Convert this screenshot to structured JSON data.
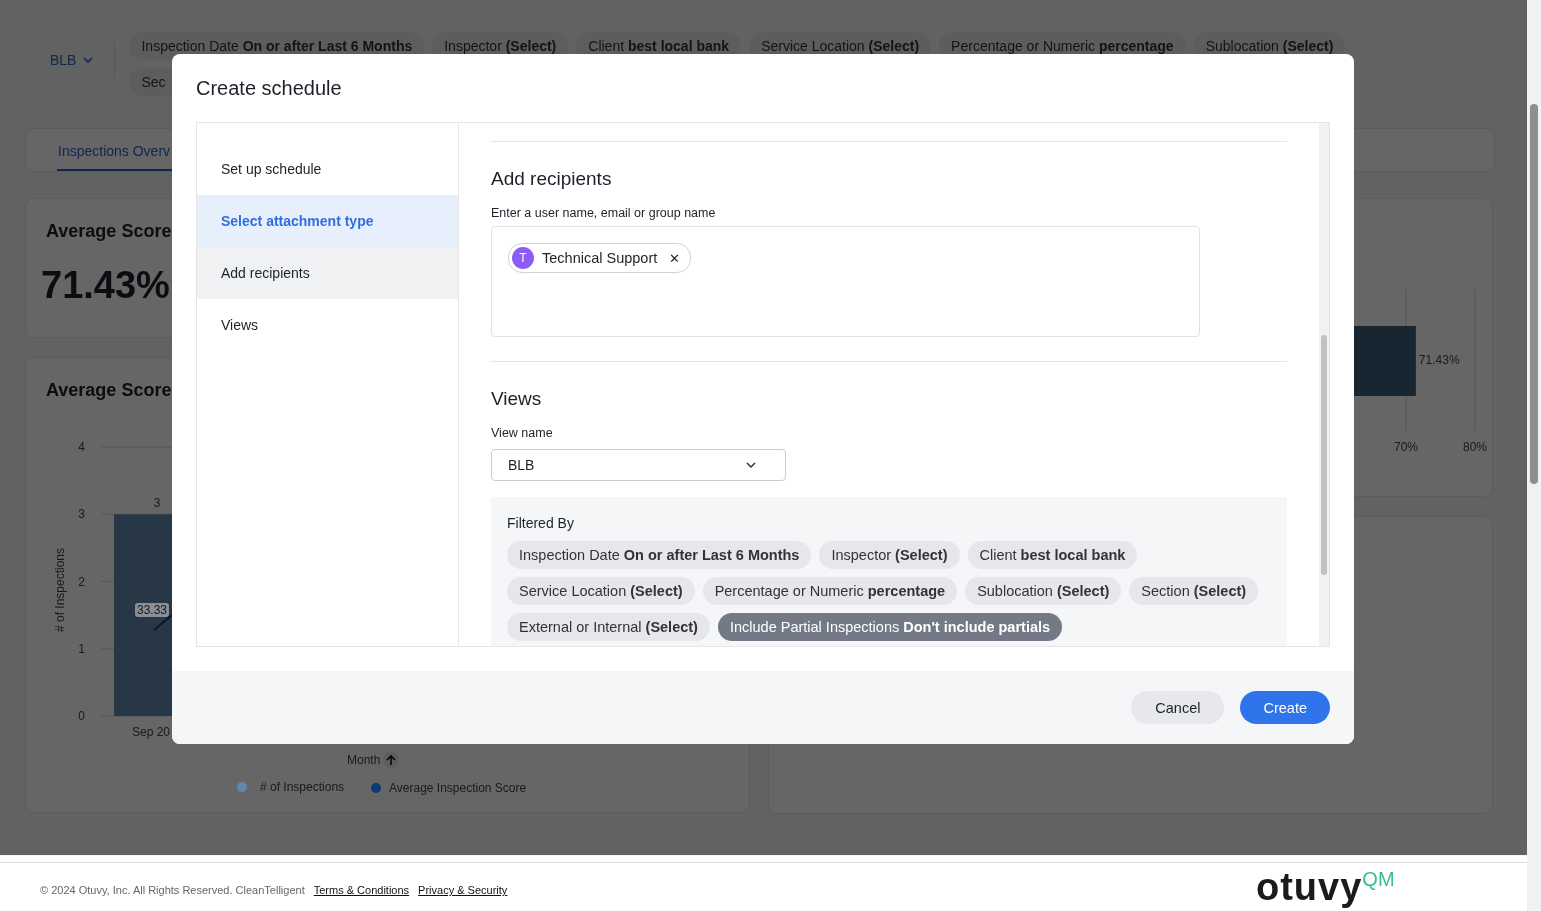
{
  "background": {
    "view_select": {
      "label": "BLB"
    },
    "filters": [
      "Inspection Date **On or after Last 6 Months**",
      "Inspector **(Select)**",
      "Client **best local bank**",
      "Service Location **(Select)**",
      "Percentage or Numeric **percentage**",
      "Sublocation **(Select)**",
      "Sec"
    ],
    "tabs": [
      {
        "label": "Inspections Overv",
        "selected": true
      }
    ],
    "score_card": {
      "title": "Average Score",
      "value": "71.43%"
    },
    "trend_card": {
      "title": "Average Score",
      "x_axis_title": "Month",
      "chart_data": {
        "type": "bar",
        "ylabel": "# of Inspections",
        "categories": [
          "Sep 20"
        ],
        "series": [
          {
            "name": "# of Inspections",
            "color": "#6189ad",
            "values": [
              3
            ]
          }
        ],
        "ylim": [
          0,
          4
        ],
        "yticks": [
          0,
          1,
          2,
          3,
          4
        ],
        "grid": true,
        "data_labels": true
      },
      "line_series": {
        "name": "Average Inspection Score",
        "color": "#0b3a6e",
        "label": "33.33"
      }
    },
    "bar_card": {
      "chart_data": {
        "type": "bar",
        "orientation": "horizontal",
        "values": [
          71.43
        ],
        "xlim": [
          0,
          80
        ],
        "xticks": [
          {
            "value": 70,
            "label": "70%"
          },
          {
            "value": 80,
            "label": "80%"
          }
        ],
        "grid": true,
        "value_labels": [
          "71.43%"
        ]
      }
    },
    "footer": {
      "copyright": "© 2024 Otuvy, Inc. All Rights Reserved. CleanTelligent",
      "links": [
        "Terms & Conditions",
        "Privacy & Security"
      ],
      "logo": "otuvy",
      "logo_suffix": "QM"
    }
  },
  "dialog": {
    "title": "Create schedule",
    "steps": [
      {
        "label": "Set up schedule",
        "selected": false,
        "hovered": false
      },
      {
        "label": "Select attachment type",
        "selected": true,
        "hovered": false
      },
      {
        "label": "Add recipients",
        "selected": false,
        "hovered": true
      },
      {
        "label": "Views",
        "selected": false,
        "hovered": false
      }
    ],
    "recipients": {
      "heading": "Add recipients",
      "label": "Enter a user name, email or group name",
      "chips": [
        {
          "initial": "T",
          "name": "Technical Support",
          "color": "#8b5cf6",
          "remove": "✕"
        }
      ]
    },
    "views": {
      "heading": "Views",
      "label": "View name",
      "value": "BLB",
      "filtered_by": "Filtered By",
      "filters": [
        {
          "label": "Inspection Date **On or after Last 6 Months**",
          "active": false
        },
        {
          "label": "Inspector **(Select)**",
          "active": false
        },
        {
          "label": "Client **best local bank**",
          "active": false
        },
        {
          "label": "Service Location **(Select)**",
          "active": false
        },
        {
          "label": "Percentage or Numeric **percentage**",
          "active": false
        },
        {
          "label": "Sublocation **(Select)**",
          "active": false
        },
        {
          "label": "Section **(Select)**",
          "active": false
        },
        {
          "label": "External or Internal **(Select)**",
          "active": false
        },
        {
          "label": "Include Partial Inspections **Don't include partials**",
          "active": true
        }
      ]
    },
    "buttons": [
      {
        "label": "Cancel",
        "kind": "secondary"
      },
      {
        "label": "Create",
        "kind": "primary"
      }
    ]
  }
}
